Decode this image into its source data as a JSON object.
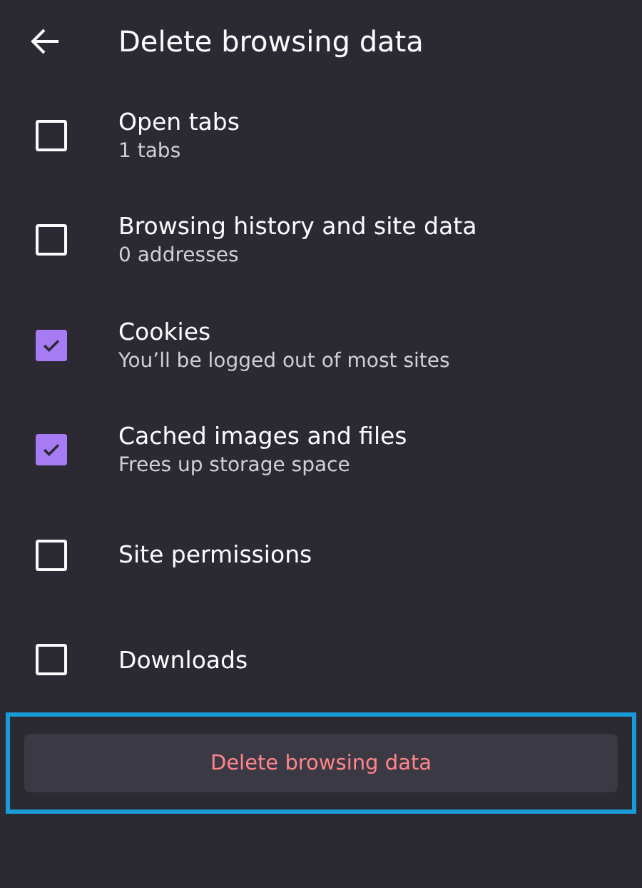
{
  "header": {
    "title": "Delete browsing data"
  },
  "options": [
    {
      "title": "Open tabs",
      "subtitle": "1 tabs",
      "checked": false
    },
    {
      "title": "Browsing history and site data",
      "subtitle": "0 addresses",
      "checked": false
    },
    {
      "title": "Cookies",
      "subtitle": "You’ll be logged out of most sites",
      "checked": true
    },
    {
      "title": "Cached images and files",
      "subtitle": "Frees up storage space",
      "checked": true
    },
    {
      "title": "Site permissions",
      "checked": false
    },
    {
      "title": "Downloads",
      "checked": false
    }
  ],
  "delete_button": {
    "label": "Delete browsing data"
  }
}
